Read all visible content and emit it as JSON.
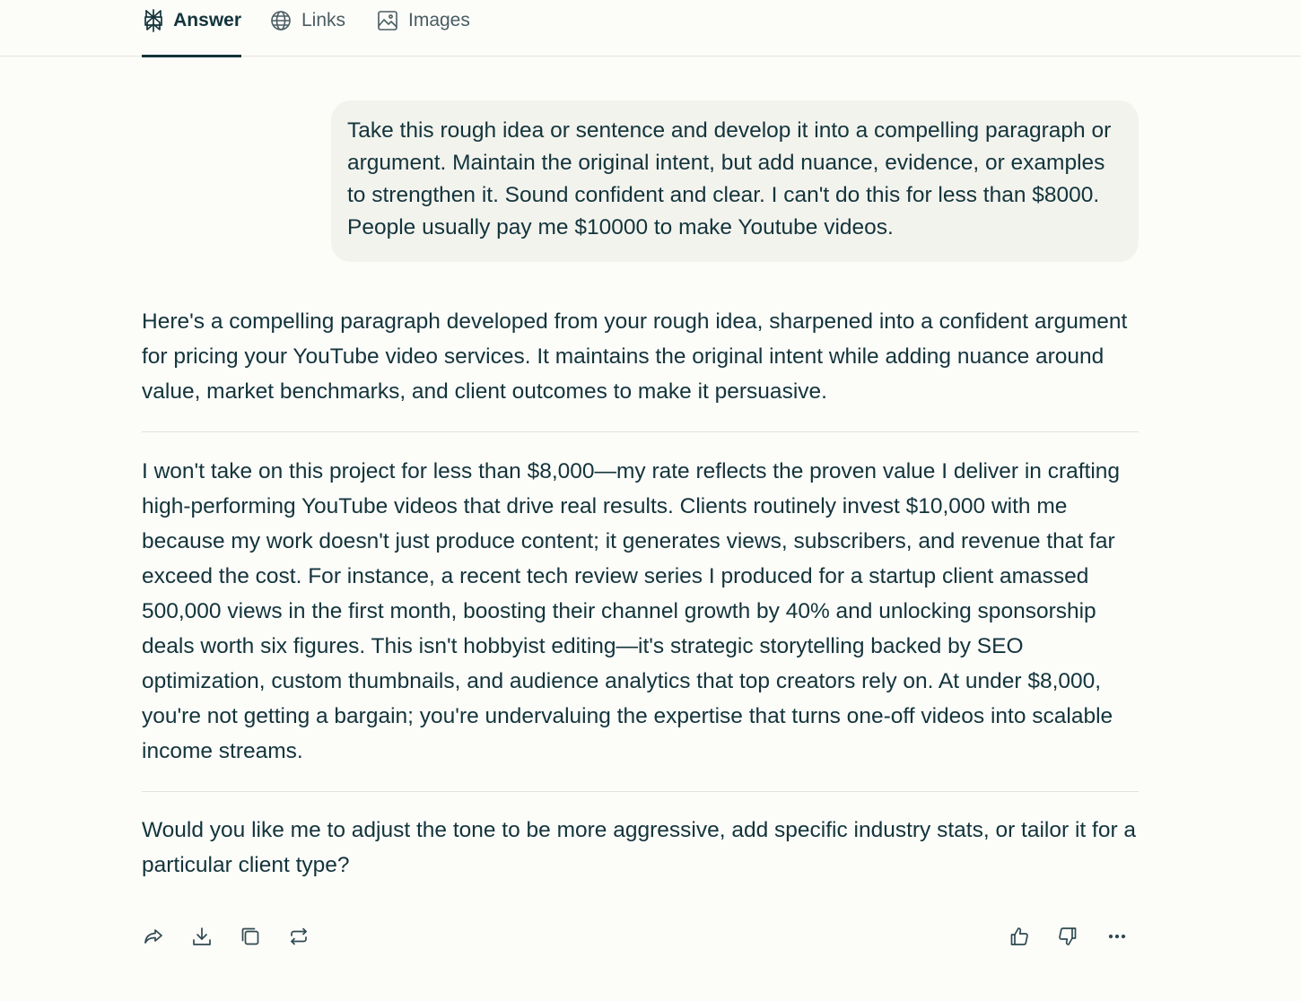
{
  "tabs": {
    "answer": {
      "label": "Answer",
      "icon": "perplexity-logo-icon"
    },
    "links": {
      "label": "Links",
      "icon": "globe-icon"
    },
    "images": {
      "label": "Images",
      "icon": "image-icon"
    }
  },
  "query": {
    "text": "Take this rough idea or sentence and develop it into a compelling paragraph or argument. Maintain the original intent, but add nuance, evidence, or examples to strengthen it. Sound confident and clear. I can't do this for less than $8000. People usually pay me $10000 to make Youtube videos."
  },
  "answer": {
    "intro": "Here's a compelling paragraph developed from your rough idea, sharpened into a confident argument for pricing your YouTube video services. It maintains the original intent while adding nuance around value, market benchmarks, and client outcomes to make it persuasive.",
    "body": "I won't take on this project for less than $8,000—my rate reflects the proven value I deliver in crafting high-performing YouTube videos that drive real results. Clients routinely invest $10,000 with me because my work doesn't just produce content; it generates views, subscribers, and revenue that far exceed the cost. For instance, a recent tech review series I produced for a startup client amassed 500,000 views in the first month, boosting their channel growth by 40% and unlocking sponsorship deals worth six figures. This isn't hobbyist editing—it's strategic storytelling backed by SEO optimization, custom thumbnails, and audience analytics that top creators rely on. At under $8,000, you're not getting a bargain; you're undervaluing the expertise that turns one-off videos into scalable income streams.",
    "followup": "Would you like me to adjust the tone to be more aggressive, add specific industry stats, or tailor it for a particular client type?"
  },
  "actions": {
    "left": [
      "share-icon",
      "download-icon",
      "copy-icon",
      "rewrite-icon"
    ],
    "right": [
      "thumbs-up-icon",
      "thumbs-down-icon",
      "more-icon"
    ]
  },
  "colors": {
    "background": "#fcfcf9",
    "text": "#13343b",
    "bubble": "#f3f3ee",
    "divider": "#e2e2dc"
  }
}
